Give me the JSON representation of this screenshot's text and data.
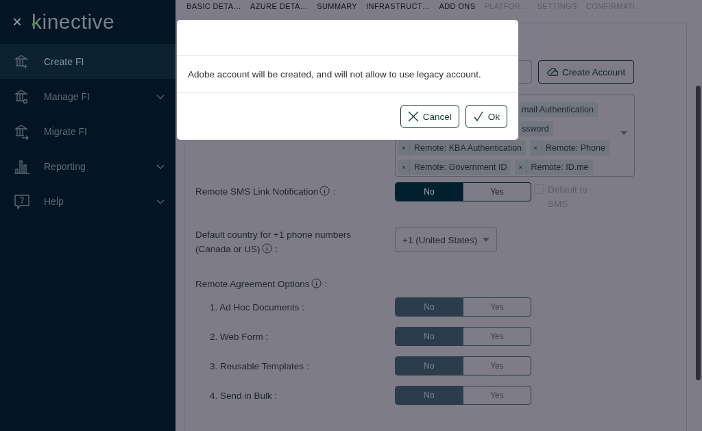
{
  "sidebar": {
    "close_label": "×",
    "logo": "kinective",
    "items": [
      {
        "label": "Create FI",
        "selected": true,
        "expandable": false
      },
      {
        "label": "Manage FI",
        "selected": false,
        "expandable": true
      },
      {
        "label": "Migrate FI",
        "selected": false,
        "expandable": false
      },
      {
        "label": "Reporting",
        "selected": false,
        "expandable": true
      },
      {
        "label": "Help",
        "selected": false,
        "expandable": true
      }
    ]
  },
  "steps": [
    {
      "label": "BASIC DETA…",
      "disabled": false
    },
    {
      "label": "AZURE DETA…",
      "disabled": false
    },
    {
      "label": "SUMMARY",
      "disabled": false
    },
    {
      "label": "INFRASTRUCT…",
      "disabled": false
    },
    {
      "label": "ADD ONS",
      "disabled": false
    },
    {
      "label": "PLATFOR…",
      "disabled": true
    },
    {
      "label": "SETTINGS",
      "disabled": true
    },
    {
      "label": "CONFIRMATI…",
      "disabled": true
    }
  ],
  "form": {
    "create_account_button": "Create Account",
    "colon": ":",
    "remove_label": "×",
    "auth_methods": [
      {
        "label": "mail Authentication",
        "removable": false
      },
      {
        "label": "ssword",
        "removable": false
      },
      {
        "label": "Remote: KBA Authentication",
        "removable": true
      },
      {
        "label": "Remote: Phone",
        "removable": true
      },
      {
        "label": "Remote: Government ID",
        "removable": true
      },
      {
        "label": "Remote: ID.me",
        "removable": true
      }
    ],
    "sms_row": {
      "label": "Remote SMS Link Notification",
      "options": [
        {
          "label": "No",
          "selected": true
        },
        {
          "label": "Yes",
          "selected": false
        }
      ],
      "disabled": false,
      "checkbox": {
        "label": "Default to SMS",
        "checked": false,
        "disabled": true
      }
    },
    "country": {
      "label": "Default country for +1 phone numbers (Canada or US)",
      "value": "+1 (United States)"
    },
    "agreement_heading": "Remote Agreement Options",
    "agreement_rows": [
      {
        "label": "1. Ad Hoc Documents :",
        "disabled": true,
        "options": [
          {
            "label": "No",
            "selected": true
          },
          {
            "label": "Yes",
            "selected": false
          }
        ]
      },
      {
        "label": "2. Web Form :",
        "disabled": true,
        "options": [
          {
            "label": "No",
            "selected": true
          },
          {
            "label": "Yes",
            "selected": false
          }
        ]
      },
      {
        "label": "3. Reusable Templates :",
        "disabled": true,
        "options": [
          {
            "label": "No",
            "selected": true
          },
          {
            "label": "Yes",
            "selected": false
          }
        ]
      },
      {
        "label": "4. Send in Bulk :",
        "disabled": true,
        "options": [
          {
            "label": "No",
            "selected": true
          },
          {
            "label": "Yes",
            "selected": false
          }
        ]
      }
    ]
  },
  "dialog": {
    "message": "Adobe account will be created, and will not allow to use legacy account.",
    "buttons": [
      {
        "label": "Cancel",
        "kind": "cancel"
      },
      {
        "label": "Ok",
        "kind": "ok"
      }
    ]
  }
}
